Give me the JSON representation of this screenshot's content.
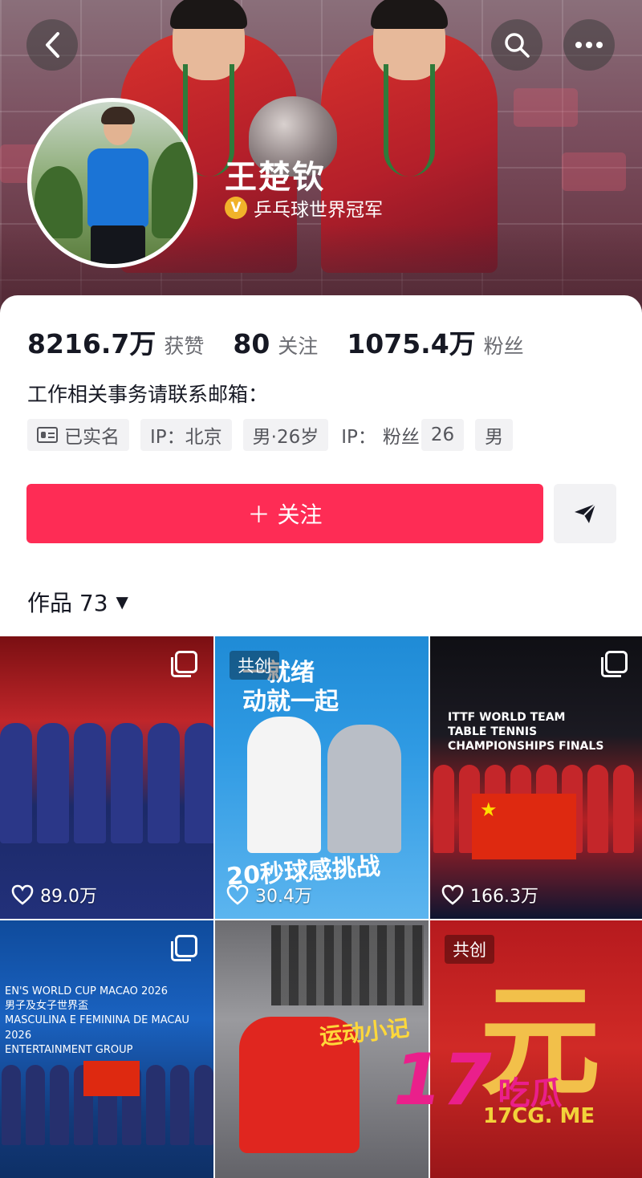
{
  "profile": {
    "name": "王楚钦",
    "verify_icon": "V",
    "verify_text": "乒乓球世界冠军"
  },
  "stats": [
    {
      "value": "8216.7万",
      "label": "获赞"
    },
    {
      "value": "80",
      "label": "关注"
    },
    {
      "value": "1075.4万",
      "label": "粉丝"
    }
  ],
  "bio": "工作相关事务请联系邮箱：",
  "tags": {
    "verified": "已实名",
    "ip": "IP：北京",
    "gender_age": "男·26岁",
    "ip2": "IP：",
    "fans": "粉丝",
    "age": "26",
    "gender": "男"
  },
  "actions": {
    "follow": "＋ 关注"
  },
  "works": {
    "label": "作品 73",
    "caret": "▼"
  },
  "grid": [
    {
      "likes": "89.0万",
      "cocreate": "",
      "multi": true
    },
    {
      "likes": "30.4万",
      "cocreate": "共创",
      "multi": false,
      "headline": "一就绪\n动就一起",
      "caption": "20秒球感挑战"
    },
    {
      "likes": "166.3万",
      "cocreate": "",
      "multi": true,
      "caption_top": "ITTF WORLD TEAM\nTABLE TENNIS\nCHAMPIONSHIPS FINALS"
    },
    {
      "likes": "",
      "cocreate": "",
      "multi": true,
      "caption_top": "EN'S WORLD CUP MACAO 2026\n男子及女子世界盃\nMASCULINA E FEMININA DE MACAU 2026\nENTERTAINMENT GROUP"
    },
    {
      "likes": "",
      "cocreate": "",
      "multi": false,
      "caption": "运动小记"
    },
    {
      "likes": "",
      "cocreate": "共创",
      "multi": false,
      "glyph": "元"
    }
  ],
  "watermark": {
    "number": "17",
    "text": "吃瓜",
    "url": "17CG. ME"
  },
  "icons": {
    "back": "chevron-left-icon",
    "search": "search-icon",
    "more": "more-dots-icon",
    "share": "send-icon",
    "heart": "heart-icon"
  },
  "colors": {
    "accent": "#fe2c55",
    "watermark_pink": "#ea1f8b",
    "watermark_yellow": "#f2d23a",
    "verify_gold": "#f1b22a"
  }
}
